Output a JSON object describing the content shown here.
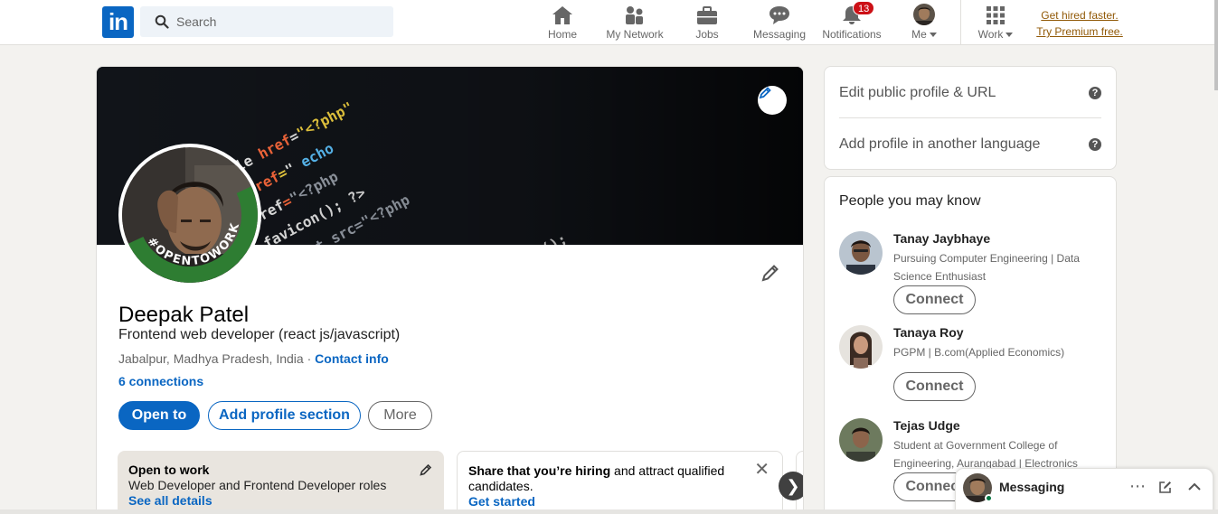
{
  "nav": {
    "search_placeholder": "Search",
    "items": [
      {
        "label": "Home",
        "icon": "home-icon"
      },
      {
        "label": "My Network",
        "icon": "network-icon"
      },
      {
        "label": "Jobs",
        "icon": "briefcase-icon"
      },
      {
        "label": "Messaging",
        "icon": "chat-icon"
      },
      {
        "label": "Notifications",
        "icon": "bell-icon",
        "badge": "13"
      },
      {
        "label": "Me",
        "icon": "avatar"
      },
      {
        "label": "Work",
        "icon": "grid-icon"
      }
    ],
    "premium_line1": "Get hired faster.",
    "premium_line2": "Try Premium free."
  },
  "profile": {
    "badge_text": "#OPENTOWORK",
    "name": "Deepak Patel",
    "headline": "Frontend web developer (react js/javascript)",
    "location": "Jabalpur, Madhya Pradesh, India",
    "location_sep": " · ",
    "contact_info": "Contact info",
    "connections": "6 connections",
    "buttons": {
      "open_to": "Open to",
      "add_section": "Add profile section",
      "more": "More"
    },
    "open_to_work": {
      "title": "Open to work",
      "roles": "Web Developer and Frontend Developer roles",
      "link": "See all details"
    },
    "hiring": {
      "bold": "Share that you’re hiring",
      "rest": " and attract qualified candidates.",
      "link": "Get started",
      "close": "✕"
    },
    "next": "❯"
  },
  "sidebar": {
    "edit_public": "Edit public profile & URL",
    "add_language": "Add profile in another language",
    "help": "?",
    "pymk_title": "People you may know",
    "people": [
      {
        "name": "Tanay Jaybhaye",
        "headline": "Pursuing Computer Engineering | Data Science Enthusiast",
        "action": "Connect"
      },
      {
        "name": "Tanaya Roy",
        "headline": "PGPM | B.com(Applied Economics)",
        "action": "Connect"
      },
      {
        "name": "Tejas Udge",
        "headline": "Student at Government College of Engineering, Aurangabad | Electronics an...",
        "action": "Connect"
      }
    ]
  },
  "messaging": {
    "title": "Messaging",
    "more": "⋯"
  },
  "colors": {
    "brand": "#0a66c2",
    "background": "#f3f2ef",
    "badge": "#cc1016",
    "premium": "#915907",
    "open_to_work_ring": "#2e7d32"
  }
}
